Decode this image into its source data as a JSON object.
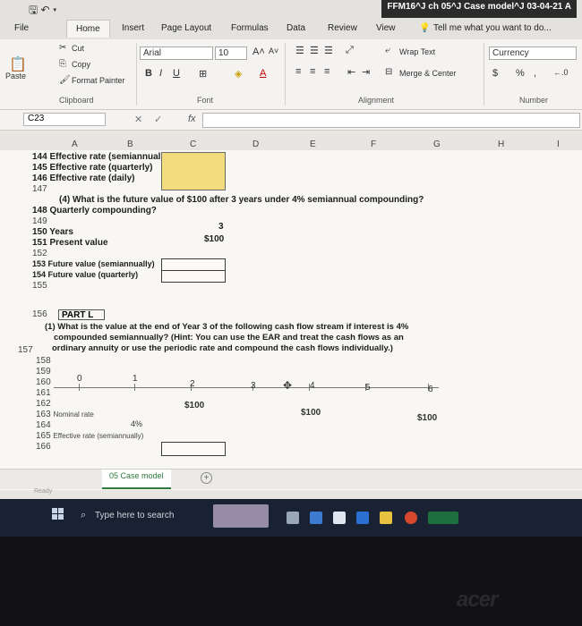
{
  "window": {
    "title": "FFM16^J ch 05^J Case model^J 03-04-21 A"
  },
  "tabs": [
    "File",
    "Home",
    "Insert",
    "Page Layout",
    "Formulas",
    "Data",
    "Review",
    "View"
  ],
  "tell_me": "Tell me what you want to do...",
  "ribbon": {
    "paste": "Paste",
    "cut": "Cut",
    "copy": "Copy",
    "format_painter": "Format Painter",
    "clipboard": "Clipboard",
    "font_name": "Arial",
    "font_size": "10",
    "bold": "B",
    "italic": "I",
    "underline": "U",
    "font_group": "Font",
    "wrap_text": "Wrap Text",
    "merge_center": "Merge & Center",
    "alignment_group": "Alignment",
    "number_format": "Currency",
    "currency_symbol": "$",
    "percent": "%",
    "number_group": "Number"
  },
  "formula_bar": {
    "name_box": "C23",
    "fx": "fx",
    "cancel": "✕",
    "enter": "✓"
  },
  "columns": [
    "A",
    "B",
    "C",
    "D",
    "E",
    "F",
    "G",
    "H",
    "I"
  ],
  "rows": [
    {
      "n": "144",
      "text": "Effective rate (semiannually)"
    },
    {
      "n": "145",
      "text": "Effective rate (quarterly)"
    },
    {
      "n": "146",
      "text": "Effective rate (daily)"
    },
    {
      "n": "147",
      "text": ""
    },
    {
      "n": "148",
      "text": "(4)  What is the future value of $100 after 3 years under 4% semiannual compounding?"
    },
    {
      "n": "148b",
      "text": "Quarterly compounding?"
    },
    {
      "n": "149",
      "text": ""
    },
    {
      "n": "150",
      "text": "Years"
    },
    {
      "n": "151",
      "text": "Present value"
    },
    {
      "n": "152",
      "text": ""
    },
    {
      "n": "153",
      "text": "Future value (semiannually)"
    },
    {
      "n": "154",
      "text": "Future value (quarterly)"
    },
    {
      "n": "155",
      "text": ""
    },
    {
      "n": "156",
      "text": "PART L"
    }
  ],
  "values": {
    "years": "3",
    "present_value": "$100"
  },
  "part_l": {
    "q_line1": "(1)  What is the value at the end of Year 3 of the following cash flow stream if interest is 4%",
    "q_line2": "compounded semiannually? (Hint: You can use the EAR and treat the cash flows as an",
    "q_line3": "ordinary annuity or use the periodic rate and compound the cash flows individually.)"
  },
  "timeline": {
    "periods": [
      "0",
      "1",
      "2",
      "3",
      "4",
      "5",
      "6"
    ],
    "cash_flows": [
      "$100",
      "$100",
      "$100"
    ]
  },
  "rates": {
    "nominal_label": "Nominal rate",
    "nominal_value": "4%",
    "effective_label": "Effective rate (semiannually)"
  },
  "row_numbers_lower": [
    "157",
    "158",
    "159",
    "160",
    "161",
    "162",
    "163",
    "164",
    "165",
    "166"
  ],
  "sheet": {
    "tab": "05 Case model",
    "status": "Ready"
  },
  "taskbar": {
    "search": "Type here to search"
  },
  "bezel": {
    "brand": "acer"
  }
}
